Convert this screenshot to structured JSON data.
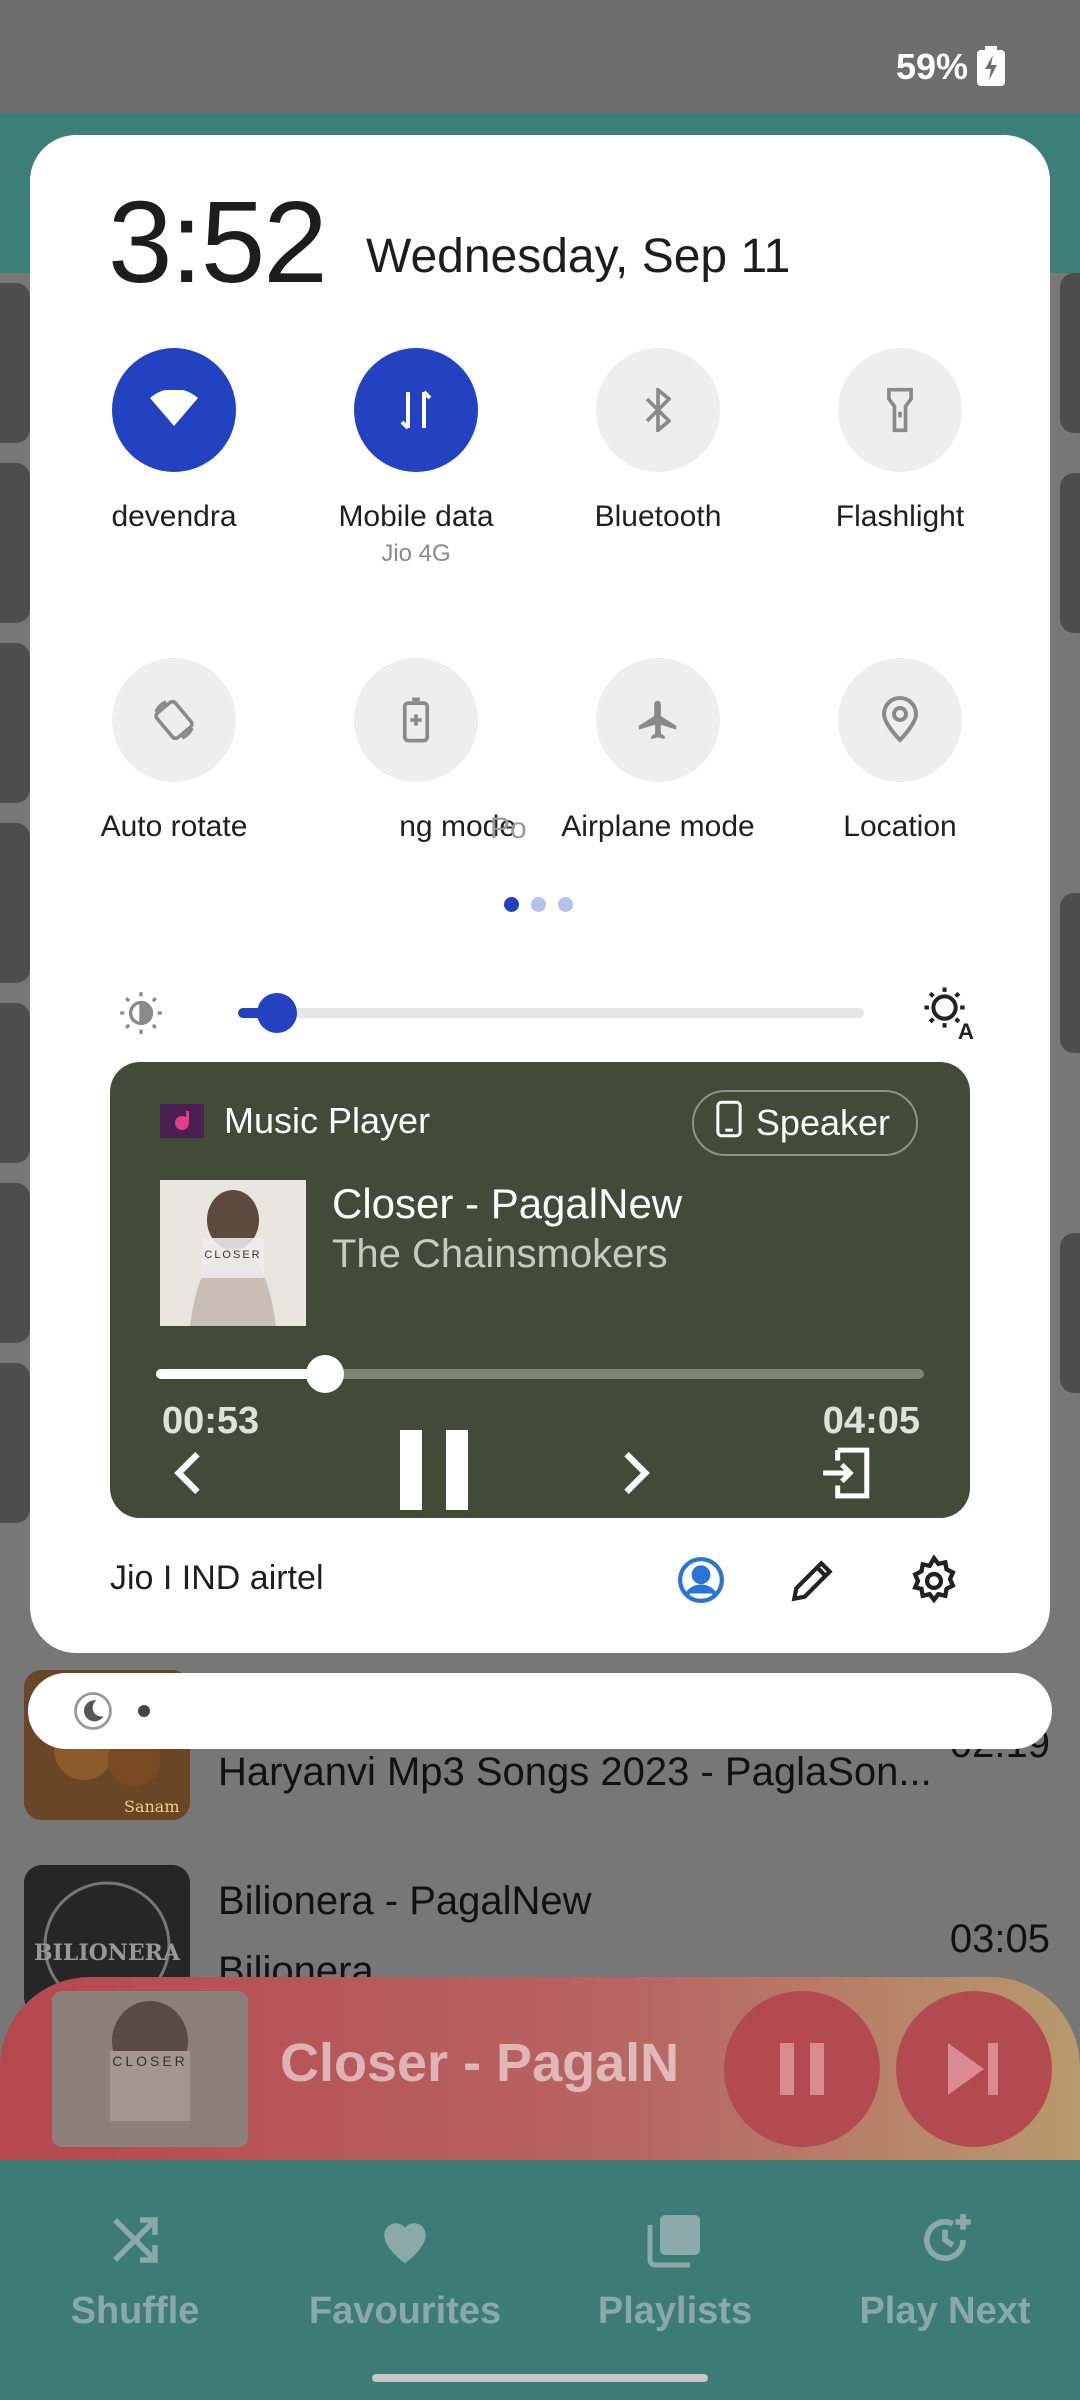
{
  "status_bar": {
    "battery_percent": "59%",
    "battery_icon": "battery-charging-icon"
  },
  "quick_settings": {
    "time": "3:52",
    "date": "Wednesday, Sep 11",
    "tiles": [
      {
        "label": "devendra",
        "sublabel": "",
        "icon": "wifi-icon",
        "active": true
      },
      {
        "label": "Mobile data",
        "sublabel": "Jio 4G",
        "icon": "mobile-data-icon",
        "active": true
      },
      {
        "label": "Bluetooth",
        "sublabel": "",
        "icon": "bluetooth-icon",
        "active": false
      },
      {
        "label": "Flashlight",
        "sublabel": "",
        "icon": "flashlight-icon",
        "active": false
      },
      {
        "label": "Auto rotate",
        "sublabel": "",
        "icon": "auto-rotate-icon",
        "active": false
      },
      {
        "label": "ng mode",
        "sublabel": "",
        "icon": "battery-saver-icon",
        "active": false
      },
      {
        "label": "Airplane mode",
        "sublabel": "",
        "icon": "airplane-icon",
        "active": false
      },
      {
        "label": "Location",
        "sublabel": "",
        "icon": "location-icon",
        "active": false
      }
    ],
    "partial_label": "Po",
    "page_count": 3,
    "current_page": 1,
    "brightness_level": 0.03,
    "media": {
      "app_name": "Music Player",
      "output_label": "Speaker",
      "track_title": "Closer - PagalNew",
      "track_artist": "The Chainsmokers",
      "elapsed": "00:53",
      "total": "04:05",
      "progress": 0.22
    },
    "carrier": "Jio I IND airtel",
    "accent_color": "#2242c2"
  },
  "background_app": {
    "songs": [
      {
        "title": "Haryanvi Mp3 Songs 2023 - PaglaSon...",
        "duration": "02:19"
      },
      {
        "title": "Bilionera - PagalNew",
        "subtitle": "Bilionera",
        "duration": "03:05"
      }
    ],
    "art_text": {
      "billionera": "BILIONERA",
      "closer": "CLOSER",
      "sanam": "Sanam"
    },
    "now_playing_title": "Closer - PagalN",
    "nav": [
      {
        "label": "Shuffle",
        "icon": "shuffle-icon"
      },
      {
        "label": "Favourites",
        "icon": "heart-icon"
      },
      {
        "label": "Playlists",
        "icon": "playlist-icon"
      },
      {
        "label": "Play Next",
        "icon": "play-next-icon"
      }
    ]
  }
}
